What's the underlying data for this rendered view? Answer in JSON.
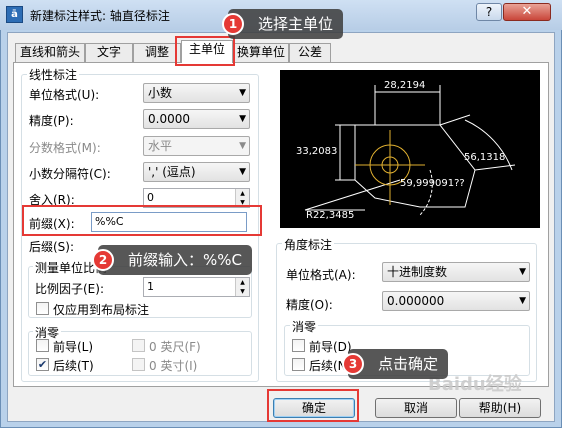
{
  "window": {
    "title": "新建标注样式: 轴直径标注",
    "help_label": "?",
    "close_label": "✕",
    "app_icon": "app-icon"
  },
  "tabs": [
    {
      "label": "直线和箭头"
    },
    {
      "label": "文字"
    },
    {
      "label": "调整"
    },
    {
      "label": "主单位",
      "active": true
    },
    {
      "label": "换算单位"
    },
    {
      "label": "公差"
    }
  ],
  "linear": {
    "group_title": "线性标注",
    "unit_format_label": "单位格式(U):",
    "unit_format_value": "小数",
    "precision_label": "精度(P):",
    "precision_value": "0.0000",
    "fraction_format_label": "分数格式(M):",
    "fraction_format_value": "水平",
    "decimal_separator_label": "小数分隔符(C):",
    "decimal_separator_value": "','  (逗点)",
    "round_off_label": "舍入(R):",
    "round_off_value": "0",
    "prefix_label": "前缀(X):",
    "prefix_value": "%%C",
    "suffix_label": "后缀(S):"
  },
  "scale": {
    "group_title": "测量单位比例",
    "factor_label": "比例因子(E):",
    "factor_value": "1",
    "layout_only_label": "仅应用到布局标注"
  },
  "zero_suppression": {
    "group_title": "消零",
    "leading_label": "前导(L)",
    "trailing_label": "后续(T)",
    "feet_label": "0 英尺(F)",
    "inches_label": "0 英寸(I)",
    "leading_checked": false,
    "trailing_checked": true
  },
  "angular": {
    "group_title": "角度标注",
    "unit_format_label": "单位格式(A):",
    "unit_format_value": "十进制度数",
    "precision_label": "精度(O):",
    "precision_value": "0.000000",
    "zero_title": "消零",
    "leading_label": "前导(D)",
    "trailing_label": "后续(N)"
  },
  "preview": {
    "dim_top": "28,2194",
    "dim_left": "33,2083",
    "dim_right": "56,1318",
    "dim_angle": "59,999091??",
    "dim_radius": "R22,3485"
  },
  "buttons": {
    "ok": "确定",
    "cancel": "取消",
    "help": "帮助(H)"
  },
  "annotations": [
    {
      "num": "1",
      "text": "选择主单位"
    },
    {
      "num": "2",
      "text": "前缀输入：%%C"
    },
    {
      "num": "3",
      "text": "点击确定"
    }
  ],
  "watermark": "Baidu经验",
  "colors": {
    "highlight_red": "#e53935",
    "callout_bg": "#404040",
    "preview_bg": "#000000",
    "preview_line": "#ffffff",
    "preview_arc": "#e0b030"
  }
}
